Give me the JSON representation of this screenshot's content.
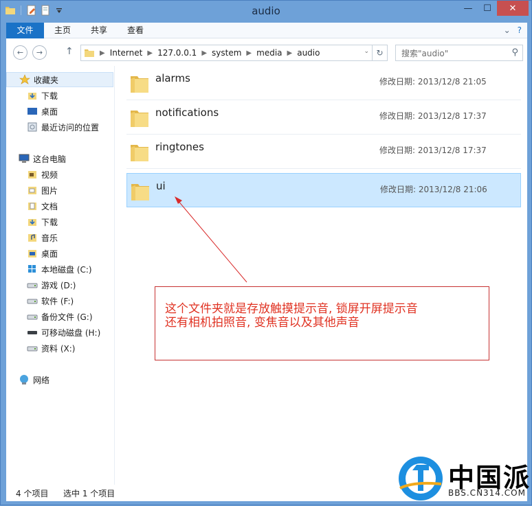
{
  "window": {
    "title": "audio",
    "minimize": "—",
    "maximize": "☐",
    "close": "✕"
  },
  "ribbon": {
    "tabs": [
      "文件",
      "主页",
      "共享",
      "查看"
    ],
    "expand": "⌄",
    "help": "?"
  },
  "nav": {
    "back": "←",
    "forward": "→",
    "up": "↑",
    "breadcrumb": [
      "Internet",
      "127.0.0.1",
      "system",
      "media",
      "audio"
    ],
    "dropdown": "⌄",
    "refresh": "↻",
    "search_placeholder": "搜索\"audio\"",
    "search_icon": "⚲"
  },
  "sidebar": {
    "favorites": {
      "label": "收藏夹",
      "items": [
        "下载",
        "桌面",
        "最近访问的位置"
      ]
    },
    "pc": {
      "label": "这台电脑",
      "items": [
        "视频",
        "图片",
        "文档",
        "下载",
        "音乐",
        "桌面",
        "本地磁盘 (C:)",
        "游戏 (D:)",
        "软件 (F:)",
        "备份文件 (G:)",
        "可移动磁盘 (H:)",
        "资料 (X:)"
      ]
    },
    "network": {
      "label": "网络"
    }
  },
  "files": [
    {
      "name": "alarms",
      "meta_label": "修改日期:",
      "date": "2013/12/8 21:05"
    },
    {
      "name": "notifications",
      "meta_label": "修改日期:",
      "date": "2013/12/8 17:37"
    },
    {
      "name": "ringtones",
      "meta_label": "修改日期:",
      "date": "2013/12/8 17:37"
    },
    {
      "name": "ui",
      "meta_label": "修改日期:",
      "date": "2013/12/8 21:06",
      "selected": true
    }
  ],
  "annotation": {
    "line1": "这个文件夹就是存放触摸提示音, 锁屏开屏提示音",
    "line2": "还有相机拍照音, 变焦音以及其他声音"
  },
  "status": {
    "count": "4 个项目",
    "selected": "选中 1 个项目"
  },
  "logo": {
    "brand": "中国派",
    "url": "BBS.CN314.COM"
  },
  "colors": {
    "accent": "#1a72c7",
    "selection": "#cce8ff",
    "annotation": "#e03222"
  }
}
